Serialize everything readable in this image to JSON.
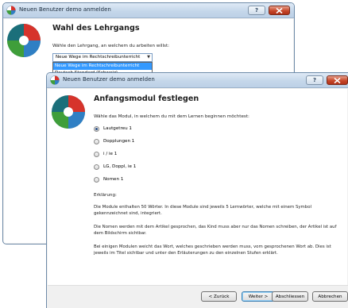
{
  "back_window": {
    "title": "Neuen Benutzer demo anmelden",
    "heading": "Wahl des Lehrgangs",
    "description": "Wähle den Lehrgang, an welchem du arbeiten willst:",
    "course_select": {
      "value": "Neue Wege im Rechtschreibunterricht",
      "options": [
        "Neue Wege im Rechtschreibunterricht",
        "Deutsch Standard (Schweiz)"
      ]
    },
    "help_label": "?"
  },
  "front_window": {
    "title": "Neuen Benutzer demo anmelden",
    "heading": "Anfangsmodul festlegen",
    "description": "Wähle das Modul, in welchem du mit dem Lernen beginnen möchtest:",
    "modules": [
      {
        "label": "Lautgetreu 1",
        "selected": true
      },
      {
        "label": "Dopplungen 1",
        "selected": false
      },
      {
        "label": "i / ie 1",
        "selected": false
      },
      {
        "label": "LG, Doppl, ie 1",
        "selected": false
      },
      {
        "label": "Nomen 1",
        "selected": false
      }
    ],
    "explanation_label": "Erklärung:",
    "paragraphs": [
      "Die Module enthalten 50 Wörter. In diese Module sind jeweils 5 Lernwörter, welche mit einem Symbol gekennzeichnet sind, integriert.",
      "Die Nomen werden mit dem Artikel gesprochen, das Kind muss aber nur das Nomen schreiben, der Artikel ist auf dem Bildschirm sichtbar.",
      "Bei einigen Modulen weicht das Wort, welches geschrieben werden muss, vom gesprochenen Wort ab. Dies ist jeweils im Titel sichtbar und unter den Erläuterungen zu den einzelnen Stufen erklärt."
    ],
    "buttons": {
      "back": "< Zurück",
      "next": "Weiter >",
      "finish": "Abschliessen",
      "cancel": "Abbrechen"
    },
    "help_label": "?"
  },
  "colors": {
    "accent": "#3399ff",
    "close_red": "#c7482a",
    "logo_red": "#d6332b",
    "logo_blue": "#2f7fc4",
    "logo_green": "#3f9e3a",
    "logo_teal": "#1b6f7a"
  },
  "icons": [
    "app-icon",
    "help-icon",
    "close-icon",
    "app-logo-icon",
    "dropdown-arrow-icon"
  ]
}
